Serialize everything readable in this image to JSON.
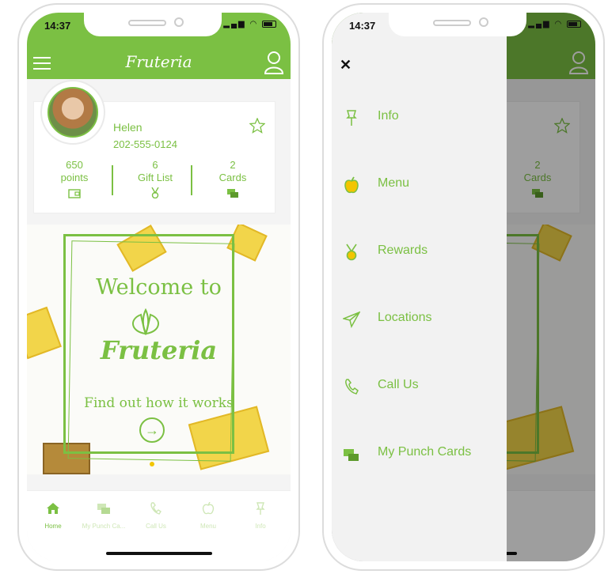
{
  "status": {
    "time": "14:37",
    "time_right": "14:37"
  },
  "app": {
    "logo": "Fruteria"
  },
  "profile": {
    "name": "Helen",
    "phone": "202-555-0124"
  },
  "stats": [
    {
      "value": "650",
      "label": "points",
      "icon": "wallet-icon"
    },
    {
      "value": "6",
      "label": "Gift List",
      "icon": "medal-icon"
    },
    {
      "value": "2",
      "label": "Cards",
      "icon": "cards-icon"
    }
  ],
  "banner": {
    "welcome": "Welcome to",
    "brand": "Fruteria",
    "cta": "Find out how it works",
    "arrow": "→"
  },
  "tabs": [
    {
      "label": "Home",
      "icon": "home-icon"
    },
    {
      "label": "My Punch Ca...",
      "icon": "punch-cards-icon"
    },
    {
      "label": "Call Us",
      "icon": "phone-icon"
    },
    {
      "label": "Menu",
      "icon": "apple-icon"
    },
    {
      "label": "Info",
      "icon": "pin-icon"
    }
  ],
  "drawer": {
    "close": "✕",
    "items": [
      {
        "label": "Info",
        "icon": "pin-icon"
      },
      {
        "label": "Menu",
        "icon": "apple-icon"
      },
      {
        "label": "Rewards",
        "icon": "medal-icon"
      },
      {
        "label": "Locations",
        "icon": "send-icon"
      },
      {
        "label": "Call Us",
        "icon": "phone-icon"
      },
      {
        "label": "My Punch Cards",
        "icon": "punch-cards-icon"
      }
    ]
  },
  "colors": {
    "brand": "#7bc043",
    "accent": "#f2c500"
  }
}
